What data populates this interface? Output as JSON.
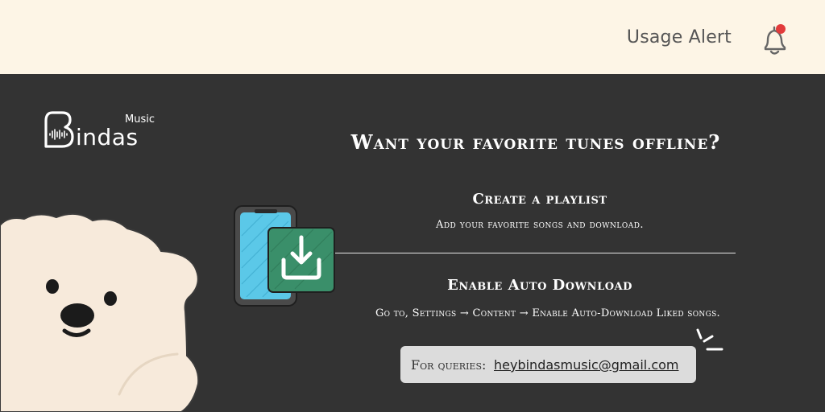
{
  "header": {
    "usage_alert_label": "Usage Alert",
    "notification_dot_color": "#e23b3b"
  },
  "brand": {
    "name": "Bindas",
    "name_rest": "indas",
    "tag": "Music"
  },
  "content": {
    "headline": "Want your favorite tunes offline?",
    "section1_title": "Create a playlist",
    "section1_desc": "Add your favorite songs and download.",
    "section2_title": "Enable Auto Download",
    "section2_desc": "Go to, Settings → Content → Enable Auto-Download Liked songs."
  },
  "contact": {
    "label": "For queries:",
    "email": "heybindasmusic@gmail.com"
  },
  "colors": {
    "topbar_bg": "#fdf5e6",
    "panel_bg": "#333333",
    "phone_blue": "#5bc8e8",
    "download_green": "#3a8f6a",
    "bear": "#f7eadb"
  },
  "icons": [
    "bell-icon",
    "phone-download-icon",
    "sparkle-icon",
    "heart-waveform-icon"
  ]
}
